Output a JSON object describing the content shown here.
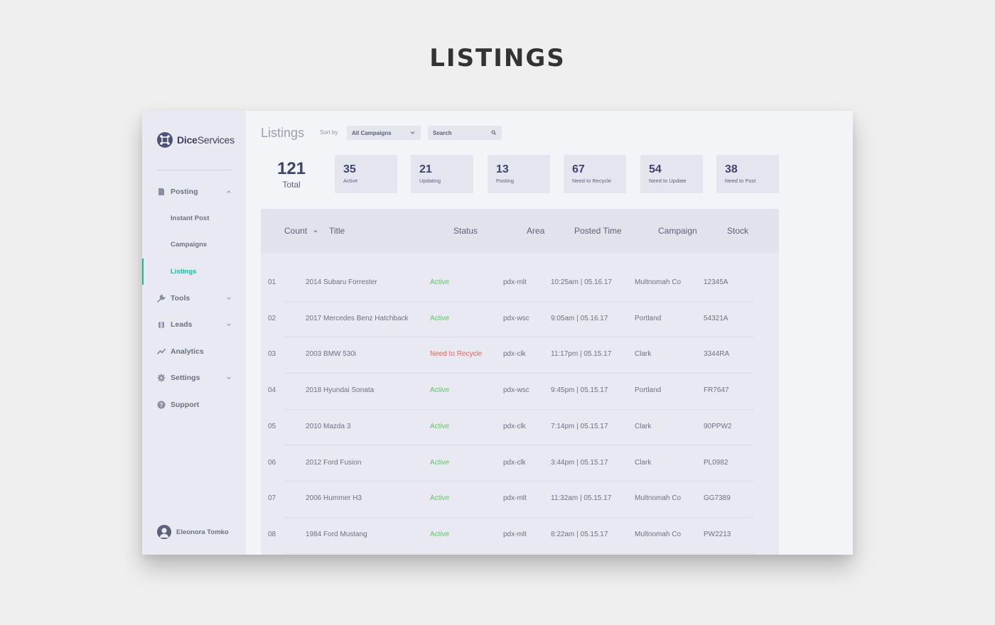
{
  "heading": "LISTINGS",
  "brand": {
    "name_bold": "Dice",
    "name_rest": "Services"
  },
  "sidebar": {
    "items": [
      {
        "label": "Posting",
        "icon": "posting-icon",
        "expanded": true
      },
      {
        "label": "Instant Post",
        "sub": true
      },
      {
        "label": "Campaigns",
        "sub": true
      },
      {
        "label": "Listings",
        "sub": true,
        "active": true
      },
      {
        "label": "Tools",
        "icon": "wrench-icon"
      },
      {
        "label": "Leads",
        "icon": "leads-icon"
      },
      {
        "label": "Analytics",
        "icon": "analytics-icon"
      },
      {
        "label": "Settings",
        "icon": "gear-icon"
      },
      {
        "label": "Support",
        "icon": "help-icon"
      }
    ],
    "user": "Eleonora Tomko"
  },
  "main": {
    "title": "Listings",
    "sort_label": "Sort by",
    "sort_value": "All Campaigns",
    "search_placeholder": "Search",
    "total": {
      "value": "121",
      "label": "Total"
    },
    "stats": [
      {
        "value": "35",
        "label": "Active"
      },
      {
        "value": "21",
        "label": "Updating"
      },
      {
        "value": "13",
        "label": "Posting"
      },
      {
        "value": "67",
        "label": "Need to Recycle"
      },
      {
        "value": "54",
        "label": "Need to Update"
      },
      {
        "value": "38",
        "label": "Need to Post"
      }
    ],
    "columns": [
      "Count",
      "Title",
      "Status",
      "Area",
      "Posted Time",
      "Campaign",
      "Stock"
    ],
    "rows": [
      {
        "count": "01",
        "title": "2014 Subaru Forrester",
        "status": "Active",
        "area": "pdx-mlt",
        "time": "10:25am  |  05.16.17",
        "campaign": "Multnomah Co",
        "stock": "12345A"
      },
      {
        "count": "02",
        "title": "2017 Mercedes Benz Hatchback",
        "status": "Active",
        "area": "pdx-wsc",
        "time": "9:05am  |  05.16.17",
        "campaign": "Portland",
        "stock": "54321A"
      },
      {
        "count": "03",
        "title": "2003 BMW 530i",
        "status": "Need to Recycle",
        "area": "pdx-clk",
        "time": "11:17pm  |  05.15.17",
        "campaign": "Clark",
        "stock": "3344RA"
      },
      {
        "count": "04",
        "title": "2018 Hyundai Sonata",
        "status": "Active",
        "area": "pdx-wsc",
        "time": "9:45pm  |  05.15.17",
        "campaign": "Portland",
        "stock": "FR7647"
      },
      {
        "count": "05",
        "title": "2010 Mazda 3",
        "status": "Active",
        "area": "pdx-clk",
        "time": "7:14pm  |  05.15.17",
        "campaign": "Clark",
        "stock": "90PPW2"
      },
      {
        "count": "06",
        "title": "2012 Ford Fusion",
        "status": "Active",
        "area": "pdx-clk",
        "time": "3:44pm  |  05.15.17",
        "campaign": "Clark",
        "stock": "PL0982"
      },
      {
        "count": "07",
        "title": "2006 Hummer H3",
        "status": "Active",
        "area": "pdx-mlt",
        "time": "11:32am  |  05.15.17",
        "campaign": "Multnomah Co",
        "stock": "GG7389"
      },
      {
        "count": "08",
        "title": "1984 Ford Mustang",
        "status": "Active",
        "area": "pdx-mlt",
        "time": "8:22am  |  05.15.17",
        "campaign": "Multnomah Co",
        "stock": "PW2213"
      }
    ]
  },
  "colors": {
    "accent": "#1fb3a3",
    "active": "#5ec46a",
    "recycle": "#e2625b",
    "brand": "#4d5279"
  }
}
